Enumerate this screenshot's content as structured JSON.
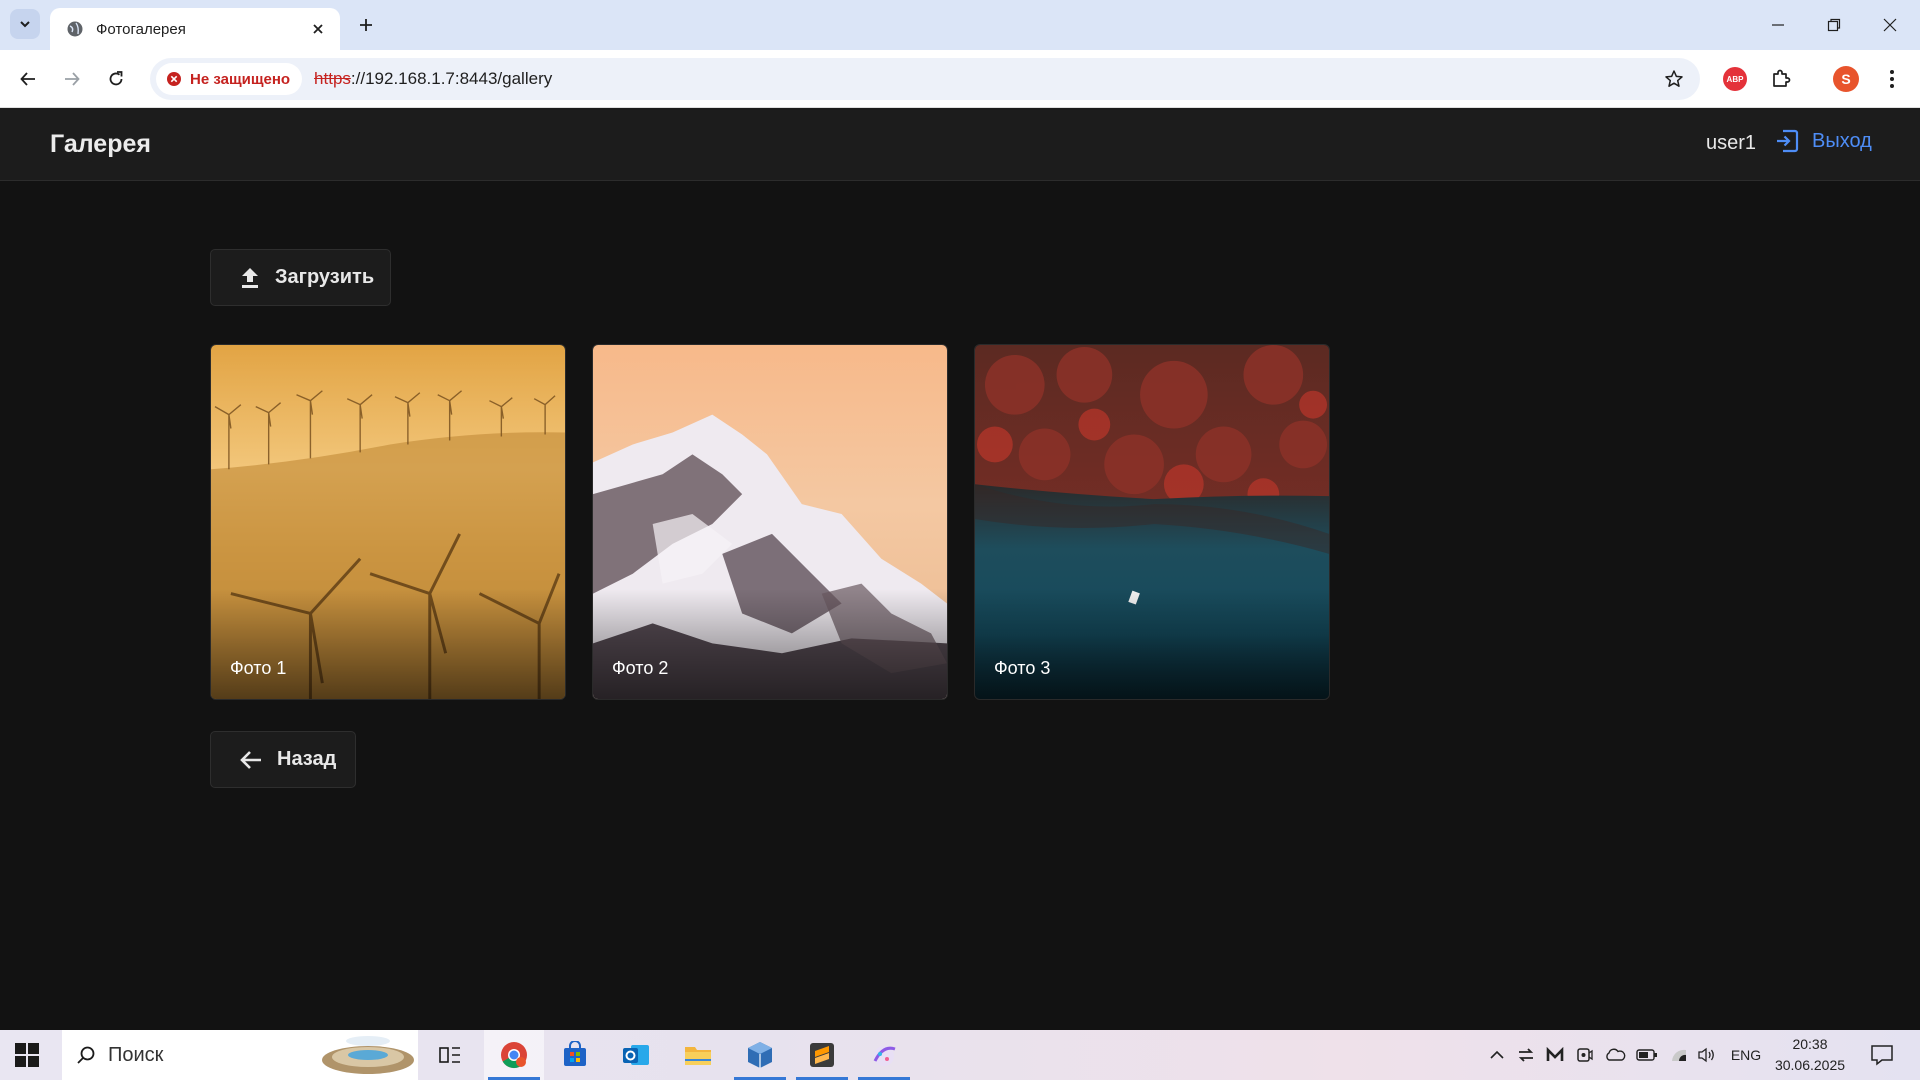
{
  "browser": {
    "tab_title": "Фотогалерея",
    "security_label": "Не защищено",
    "url_scheme": "https",
    "url_rest": "://192.168.1.7:8443/gallery",
    "abp_label": "ABP",
    "profile_initial": "S"
  },
  "app": {
    "title": "Галерея",
    "username": "user1",
    "logout_label": "Выход",
    "upload_label": "Загрузить",
    "back_label": "Назад",
    "accent_color": "#4e8df6",
    "photos": [
      {
        "caption": "Фото 1",
        "scene": "wind-turbines-golden-haze"
      },
      {
        "caption": "Фото 2",
        "scene": "snowy-mountain-peach-sky"
      },
      {
        "caption": "Фото 3",
        "scene": "red-forest-teal-lake"
      }
    ]
  },
  "taskbar": {
    "search_placeholder": "Поиск",
    "language": "ENG",
    "time": "20:38",
    "date": "30.06.2025"
  }
}
